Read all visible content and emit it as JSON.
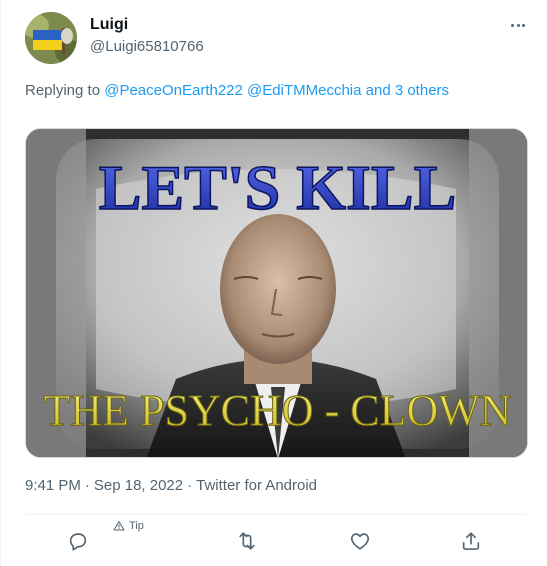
{
  "tweet": {
    "author": {
      "display_name": "Luigi",
      "handle": "@Luigi65810766",
      "avatar_icon": "avatar-ukraine-flag-icon"
    },
    "more_icon": "more-dots-icon",
    "reply_prefix": "Replying to ",
    "reply_mentions": [
      "@PeaceOnEarth222",
      "@EdiTMMecchia"
    ],
    "reply_others": "and 3 others",
    "image": {
      "caption_top": "LET'S KILL",
      "caption_bottom": "THE PSYCHO - CLOWN"
    },
    "time": "9:41 PM",
    "date": "Sep 18, 2022",
    "source": "Twitter for Android",
    "separator": "·",
    "actions": {
      "reply_icon": "reply-icon",
      "tip_label": "Tip",
      "tip_icon": "tip-icon",
      "retweet_icon": "retweet-icon",
      "like_icon": "heart-icon",
      "share_icon": "share-icon"
    }
  },
  "colors": {
    "link": "#1d9bf0",
    "secondary_text": "#536471",
    "caption_top": "#2a3fbf",
    "caption_bottom": "#e8e04a"
  }
}
